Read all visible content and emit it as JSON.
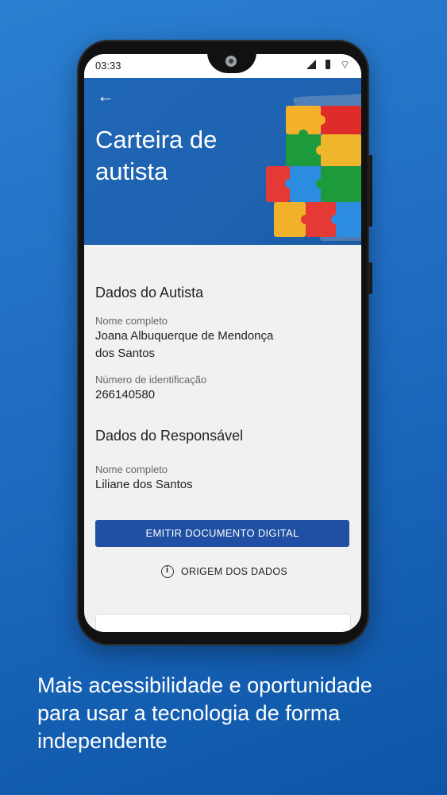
{
  "status_bar": {
    "time": "03:33"
  },
  "hero": {
    "title": "Carteira de autista"
  },
  "section_autista": {
    "title": "Dados do Autista",
    "nome_label": "Nome completo",
    "nome_value": "Joana Albuquerque de Mendonça dos Santos",
    "id_label": "Número de identificação",
    "id_value": "266140580"
  },
  "section_responsavel": {
    "title": "Dados do Responsável",
    "nome_label": "Nome completo",
    "nome_value": "Liliane dos Santos"
  },
  "actions": {
    "primary_label": "EMITIR DOCUMENTO DIGITAL",
    "secondary_label": "ORIGEM DOS DADOS"
  },
  "tagline": "Mais acessibilidade e oportunidade para usar a tecnologia de forma independente",
  "colors": {
    "primary": "#1f50a3",
    "hero_bg": "#1f66b4",
    "page_bg": "#2a7fd1"
  }
}
